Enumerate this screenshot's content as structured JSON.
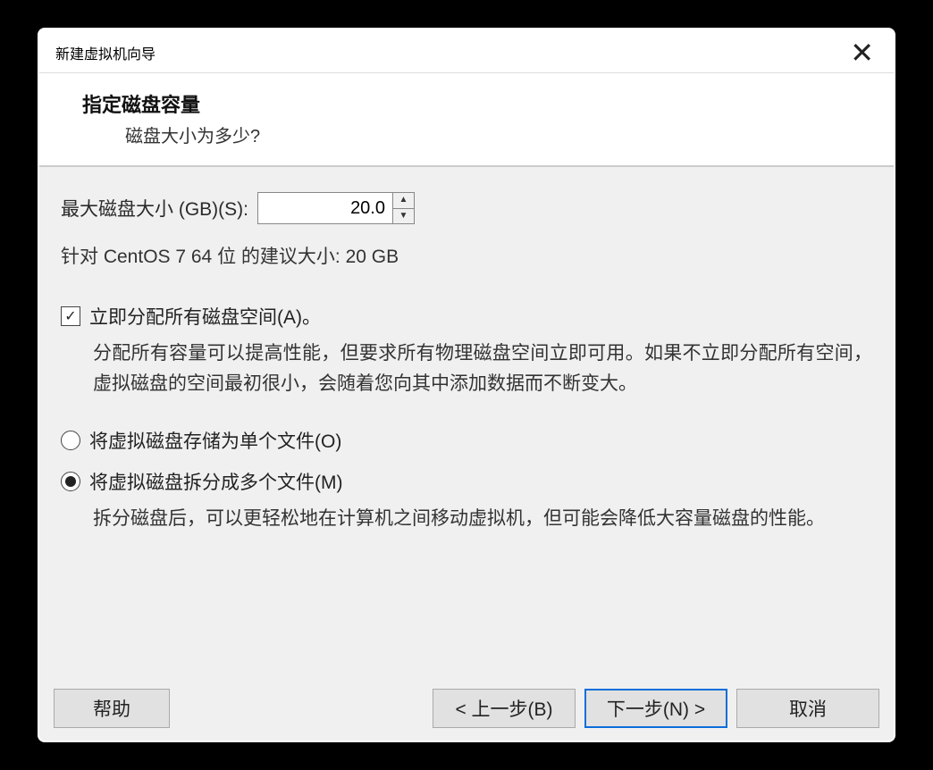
{
  "window": {
    "title": "新建虚拟机向导"
  },
  "header": {
    "title": "指定磁盘容量",
    "subtitle": "磁盘大小为多少?"
  },
  "diskSize": {
    "label": "最大磁盘大小 (GB)(S):",
    "value": "20.0",
    "recommend": "针对 CentOS 7 64 位 的建议大小: 20 GB"
  },
  "allocate": {
    "label": "立即分配所有磁盘空间(A)。",
    "checked": true,
    "desc": "分配所有容量可以提高性能，但要求所有物理磁盘空间立即可用。如果不立即分配所有空间，虚拟磁盘的空间最初很小，会随着您向其中添加数据而不断变大。"
  },
  "storage": {
    "singleFile": {
      "label": "将虚拟磁盘存储为单个文件(O)",
      "selected": false
    },
    "splitFiles": {
      "label": "将虚拟磁盘拆分成多个文件(M)",
      "selected": true,
      "desc": "拆分磁盘后，可以更轻松地在计算机之间移动虚拟机，但可能会降低大容量磁盘的性能。"
    }
  },
  "buttons": {
    "help": "帮助",
    "back": "< 上一步(B)",
    "next": "下一步(N) >",
    "cancel": "取消"
  }
}
